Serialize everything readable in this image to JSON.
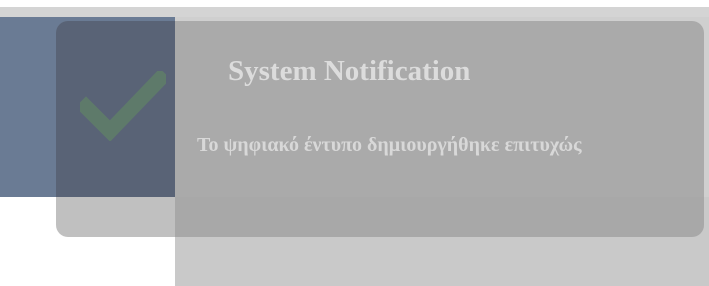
{
  "notification": {
    "title": "System Notification",
    "message": "Το ψηφιακό έντυπο δημιουργήθηκε επιτυχώς",
    "icon": "checkmark-icon",
    "icon_color": "#5e7a6a"
  },
  "colors": {
    "overlay": "#8c8c8c",
    "backdrop_panel": "#6a7b94",
    "text": "#dcdcdc"
  }
}
